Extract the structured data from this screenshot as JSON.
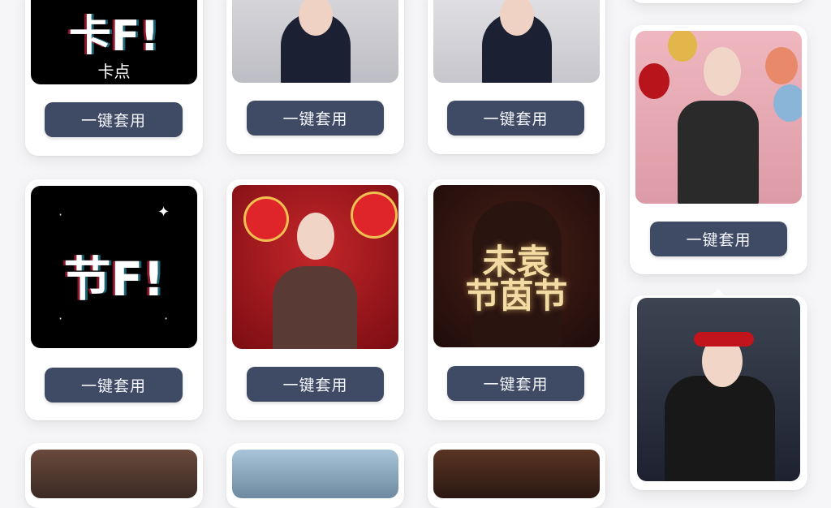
{
  "apply_label": "一键套用",
  "templates": {
    "kadian": {
      "big_text": "卡F!",
      "sub_text": "卡点"
    },
    "jiedian": {
      "big_text": "节F!"
    },
    "festival": {
      "line1": "未袁",
      "line2": "节茵节"
    }
  },
  "icons": {
    "sparkle": "✦",
    "dot": "·"
  },
  "colors": {
    "button_bg": "#3f4a64",
    "button_text": "#f4f6fb",
    "page_bg": "#f6f6f8"
  }
}
